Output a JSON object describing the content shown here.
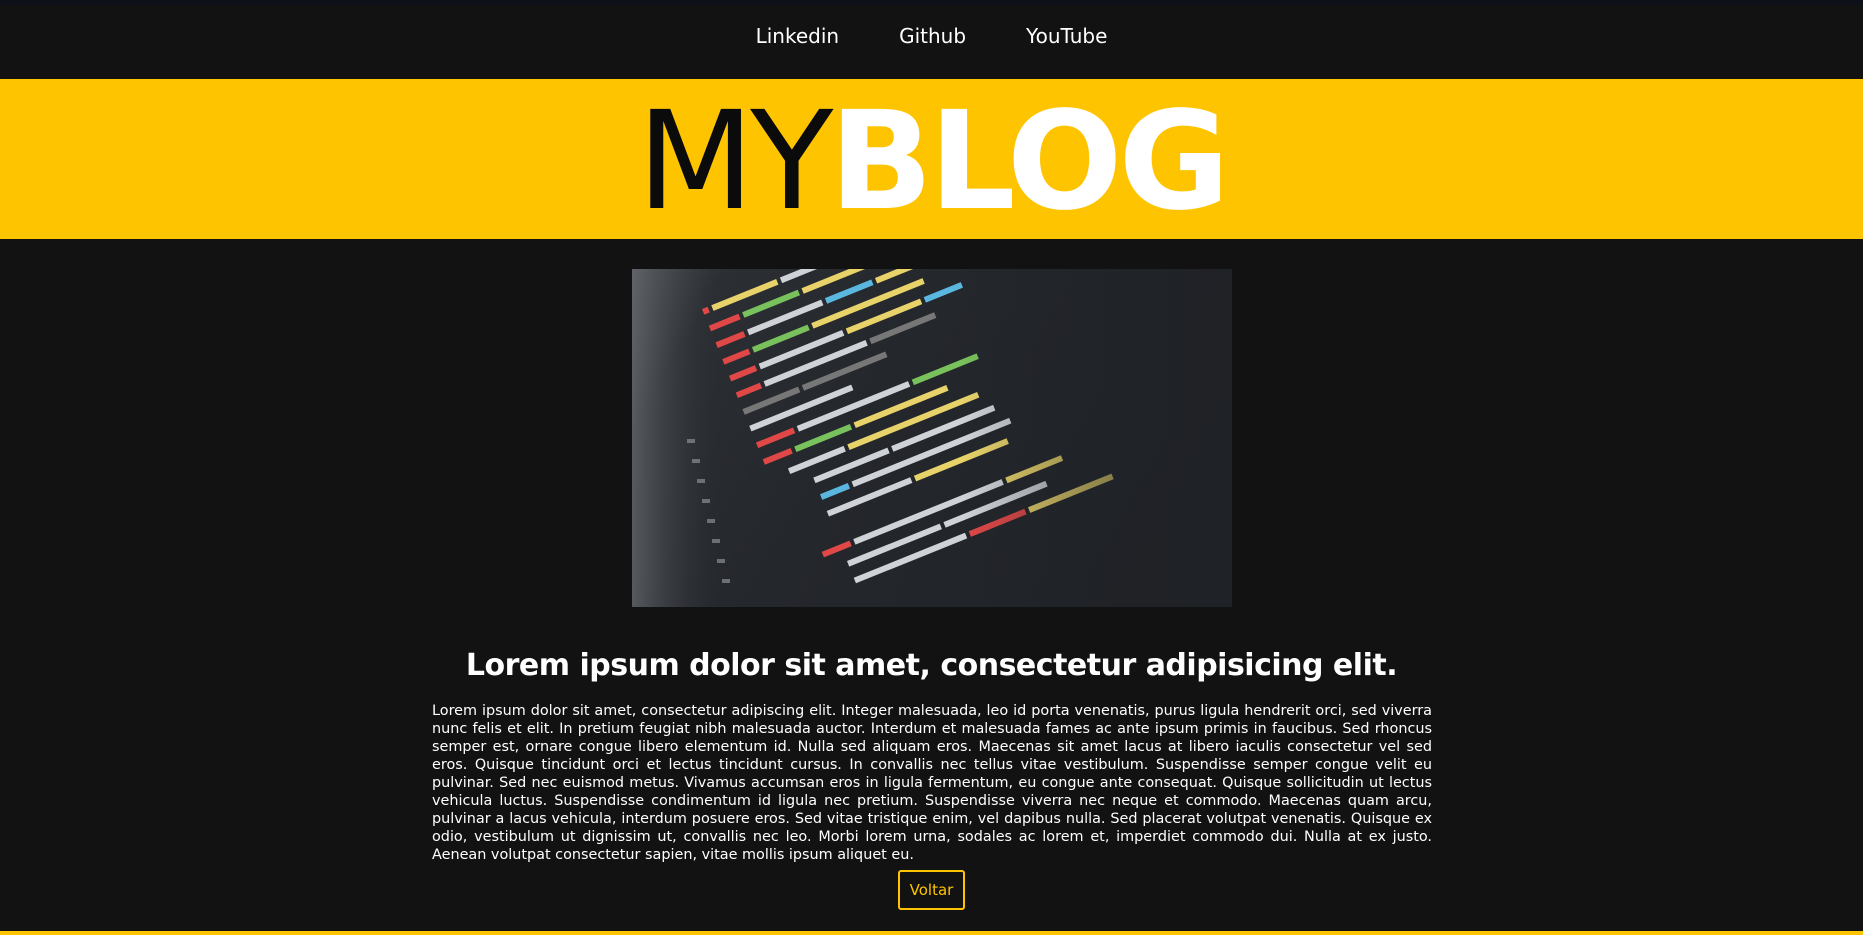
{
  "nav": {
    "links": [
      "Linkedin",
      "Github",
      "YouTube"
    ]
  },
  "logo": {
    "part1": "MY",
    "part2": "BLOG"
  },
  "article": {
    "title": "Lorem ipsum dolor sit amet, consectetur adipisicing elit.",
    "body": "Lorem ipsum dolor sit amet, consectetur adipiscing elit. Integer malesuada, leo id porta venenatis, purus ligula hendrerit orci, sed viverra nunc felis et elit. In pretium feugiat nibh malesuada auctor. Interdum et malesuada fames ac ante ipsum primis in faucibus. Sed rhoncus semper est, ornare congue libero elementum id. Nulla sed aliquam eros. Maecenas sit amet lacus at libero iaculis consectetur vel sed eros. Quisque tincidunt orci et lectus tincidunt cursus. In convallis nec tellus vitae vestibulum. Suspendisse semper congue velit eu pulvinar. Sed nec euismod metus. Vivamus accumsan eros in ligula fermentum, eu congue ante consequat. Quisque sollicitudin ut lectus vehicula luctus. Suspendisse condimentum id ligula nec pretium. Suspendisse viverra nec neque et commodo. Maecenas quam arcu, pulvinar a lacus vehicula, interdum posuere eros. Sed vitae tristique enim, vel dapibus nulla. Sed placerat volutpat venenatis. Quisque ex odio, vestibulum ut dignissim ut, convallis nec leo. Morbi lorem urna, sodales ac lorem et, imperdiet commodo dui. Nulla at ex justo. Aenean volutpat consectetur sapien, vitae mollis ipsum aliquet eu.",
    "back_label": "Voltar"
  },
  "colors": {
    "accent": "#ffc400",
    "background": "#121212",
    "text": "#ffffff"
  }
}
